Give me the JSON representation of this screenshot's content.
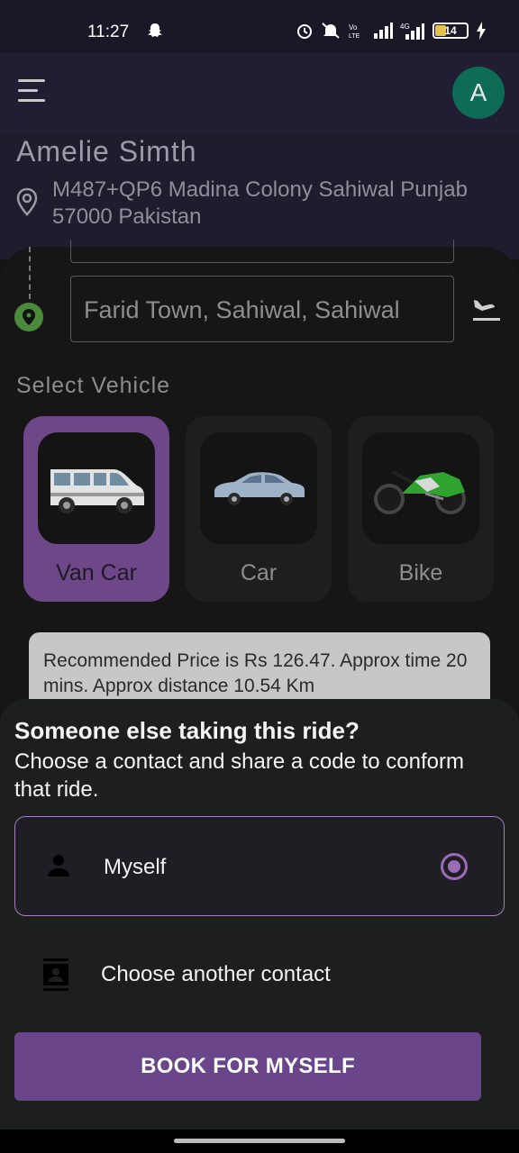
{
  "status_bar": {
    "time": "11:27",
    "network_label": "4G",
    "battery": "14"
  },
  "app_bar": {
    "avatar_initial": "A"
  },
  "user": {
    "name": "Amelie Simth",
    "address": "M487+QP6 Madina Colony Sahiwal Punjab 57000 Pakistan"
  },
  "route": {
    "destination": "Farid Town, Sahiwal, Sahiwal"
  },
  "select_vehicle": {
    "title": "Select Vehicle",
    "vehicles": [
      {
        "label": "Van Car",
        "selected": true
      },
      {
        "label": "Car",
        "selected": false
      },
      {
        "label": "Bike",
        "selected": false
      }
    ]
  },
  "price_info": "Recommended Price is Rs 126.47. Approx time 20 mins. Approx distance 10.54 Km",
  "sheet": {
    "title": "Someone else taking this ride?",
    "subtitle": "Choose a contact and share a code to conform that ride.",
    "options": [
      {
        "label": "Myself",
        "selected": true
      },
      {
        "label": "Choose another contact",
        "selected": false
      }
    ],
    "book_button": "BOOK FOR MYSELF"
  },
  "colors": {
    "accent": "#6a4589",
    "selected_vehicle": "#6d4787",
    "avatar": "#0e6b56"
  }
}
